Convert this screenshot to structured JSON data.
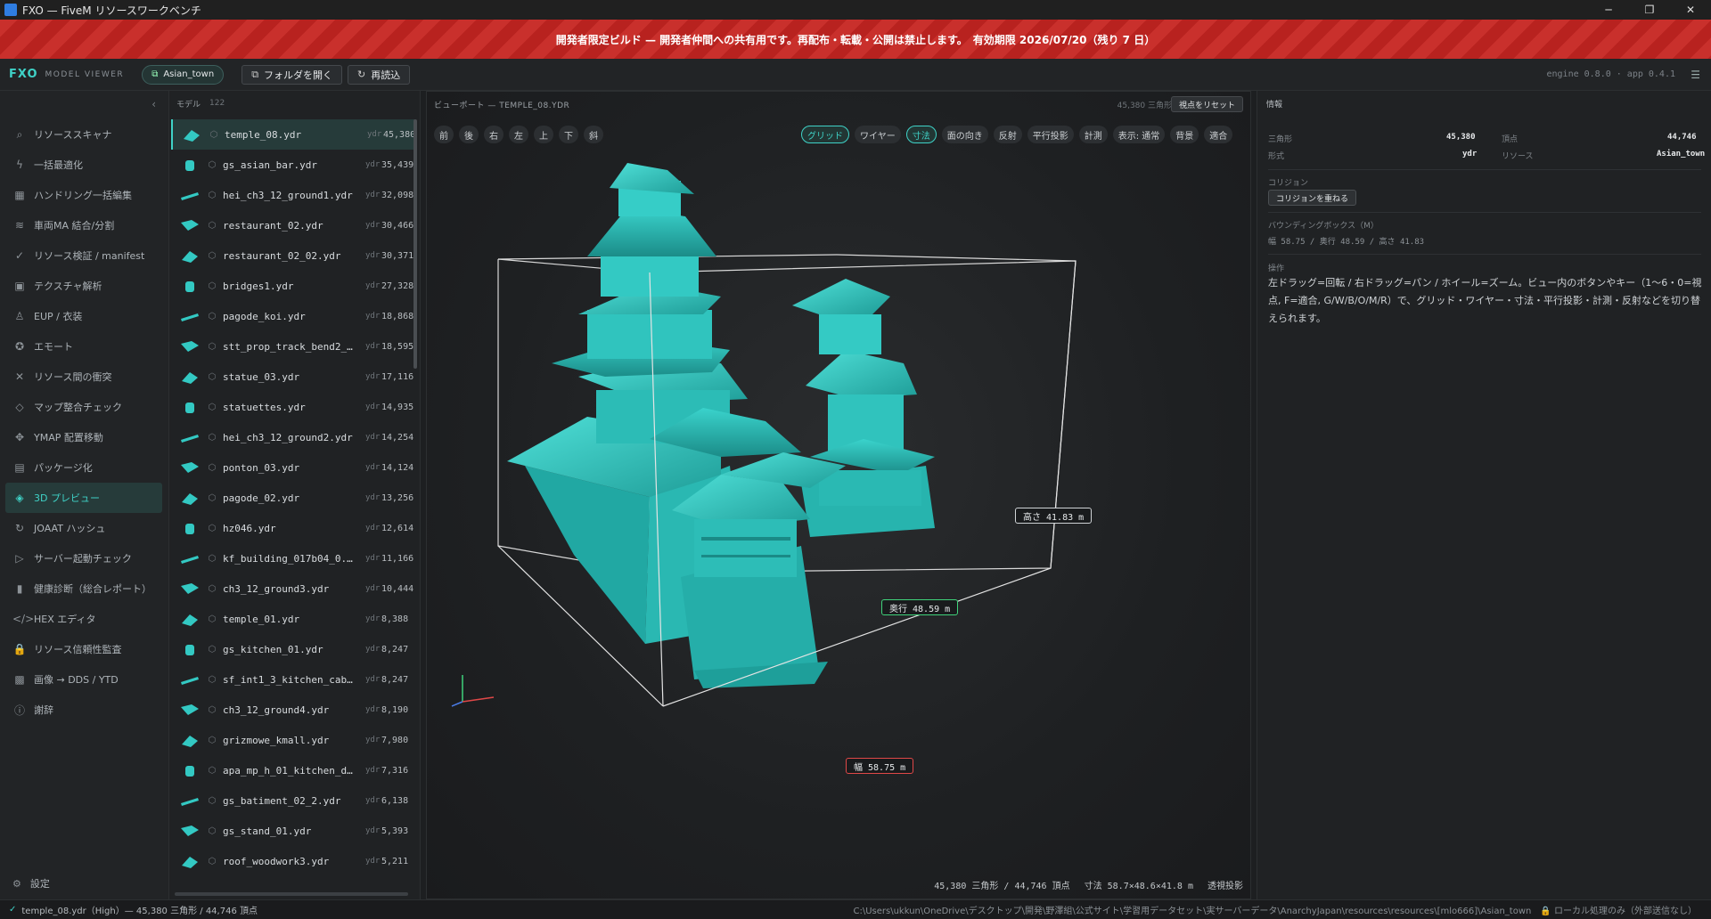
{
  "window": {
    "title": "FXO — FiveM リソースワークベンチ",
    "ctrl_min": "─",
    "ctrl_max": "❐",
    "ctrl_close": "✕"
  },
  "banner": {
    "text": "開発者限定ビルド — 開発者仲間への共有用です。再配布・転載・公開は禁止します。　有効期限 2026/07/20（残り 7 日）"
  },
  "toolbar": {
    "brand": "FXO",
    "brand_sub": "MODEL VIEWER",
    "chip": "Asian_town",
    "open_folder": "フォルダを開く",
    "reload": "再読込",
    "version": "engine 0.8.0 · app 0.4.1"
  },
  "nav": {
    "items": [
      {
        "label": "リソーススキャナ",
        "icon": "search-icon"
      },
      {
        "label": "一括最適化",
        "icon": "bolt-icon"
      },
      {
        "label": "ハンドリング一括編集",
        "icon": "grid-icon"
      },
      {
        "label": "車両MA 結合/分割",
        "icon": "layers-icon"
      },
      {
        "label": "リソース検証 / manifest",
        "icon": "check-circle-icon"
      },
      {
        "label": "テクスチャ解析",
        "icon": "image-icon"
      },
      {
        "label": "EUP / 衣装",
        "icon": "user-icon"
      },
      {
        "label": "エモート",
        "icon": "accessibility-icon"
      },
      {
        "label": "リソース間の衝突",
        "icon": "x-icon"
      },
      {
        "label": "マップ整合チェック",
        "icon": "diamond-icon"
      },
      {
        "label": "YMAP 配置移動",
        "icon": "move-icon"
      },
      {
        "label": "パッケージ化",
        "icon": "package-icon"
      },
      {
        "label": "3D プレビュー",
        "icon": "cube-icon",
        "active": true
      },
      {
        "label": "JOAAT ハッシュ",
        "icon": "refresh-icon"
      },
      {
        "label": "サーバー起動チェック",
        "icon": "play-icon"
      },
      {
        "label": "健康診断（総合レポート）",
        "icon": "bar-chart-icon"
      },
      {
        "label": "HEX エディタ",
        "icon": "code-icon"
      },
      {
        "label": "リソース信頼性監査",
        "icon": "lock-icon"
      },
      {
        "label": "画像 → DDS / YTD",
        "icon": "checker-icon"
      },
      {
        "label": "謝辞",
        "icon": "info-icon"
      }
    ],
    "settings": "設定"
  },
  "models": {
    "header": "モデル",
    "count": "122",
    "rows": [
      {
        "name": "temple_08.ydr",
        "ext": "ydr",
        "tris": "45,380",
        "active": true
      },
      {
        "name": "gs_asian_bar.ydr",
        "ext": "ydr",
        "tris": "35,439"
      },
      {
        "name": "hei_ch3_12_ground1.ydr",
        "ext": "ydr",
        "tris": "32,098"
      },
      {
        "name": "restaurant_02.ydr",
        "ext": "ydr",
        "tris": "30,466"
      },
      {
        "name": "restaurant_02_02.ydr",
        "ext": "ydr",
        "tris": "30,371"
      },
      {
        "name": "bridges1.ydr",
        "ext": "ydr",
        "tris": "27,328"
      },
      {
        "name": "pagode_koi.ydr",
        "ext": "ydr",
        "tris": "18,868"
      },
      {
        "name": "stt_prop_track_bend2_bar_...",
        "ext": "ydr",
        "tris": "18,595"
      },
      {
        "name": "statue_03.ydr",
        "ext": "ydr",
        "tris": "17,116"
      },
      {
        "name": "statuettes.ydr",
        "ext": "ydr",
        "tris": "14,935"
      },
      {
        "name": "hei_ch3_12_ground2.ydr",
        "ext": "ydr",
        "tris": "14,254"
      },
      {
        "name": "ponton_03.ydr",
        "ext": "ydr",
        "tris": "14,124"
      },
      {
        "name": "pagode_02.ydr",
        "ext": "ydr",
        "tris": "13,256"
      },
      {
        "name": "hz046.ydr",
        "ext": "ydr",
        "tris": "12,614"
      },
      {
        "name": "kf_building_017b04_0.ydr",
        "ext": "ydr",
        "tris": "11,166"
      },
      {
        "name": "ch3_12_ground3.ydr",
        "ext": "ydr",
        "tris": "10,444"
      },
      {
        "name": "temple_01.ydr",
        "ext": "ydr",
        "tris": "8,388"
      },
      {
        "name": "gs_kitchen_01.ydr",
        "ext": "ydr",
        "tris": "8,247"
      },
      {
        "name": "sf_int1_3_kitchen_cabinets...",
        "ext": "ydr",
        "tris": "8,247"
      },
      {
        "name": "ch3_12_ground4.ydr",
        "ext": "ydr",
        "tris": "8,190"
      },
      {
        "name": "grizmowe_kmall.ydr",
        "ext": "ydr",
        "tris": "7,980"
      },
      {
        "name": "apa_mp_h_01_kitchen_dini...",
        "ext": "ydr",
        "tris": "7,316"
      },
      {
        "name": "gs_batiment_02_2.ydr",
        "ext": "ydr",
        "tris": "6,138"
      },
      {
        "name": "gs_stand_01.ydr",
        "ext": "ydr",
        "tris": "5,393"
      },
      {
        "name": "roof_woodwork3.ydr",
        "ext": "ydr",
        "tris": "5,211"
      }
    ]
  },
  "viewport": {
    "header": "ビューポート — TEMPLE_08.YDR",
    "tris": "45,380 三角形",
    "reset": "視点をリセット",
    "views": [
      "前",
      "後",
      "右",
      "左",
      "上",
      "下",
      "斜"
    ],
    "toggles": [
      {
        "label": "グリッド",
        "on": true
      },
      {
        "label": "ワイヤー",
        "on": false
      },
      {
        "label": "寸法",
        "on": true
      },
      {
        "label": "面の向き",
        "on": false
      },
      {
        "label": "反射",
        "on": false
      },
      {
        "label": "平行投影",
        "on": false
      },
      {
        "label": "計測",
        "on": false
      },
      {
        "label": "表示: 通常",
        "on": false
      },
      {
        "label": "背景",
        "on": false
      },
      {
        "label": "適合",
        "on": false
      }
    ],
    "height_label": "高さ 41.83 m",
    "depth_label": "奥行 48.59 m",
    "width_label": "幅 58.75 m",
    "status": "45,380 三角形 / 44,746 頂点　 寸法 58.7×48.6×41.8 m　 透視投影"
  },
  "info": {
    "header": "情報",
    "tri_k": "三角形",
    "tri_v": "45,380",
    "vert_k": "頂点",
    "vert_v": "44,746",
    "fmt_k": "形式",
    "fmt_v": "ydr",
    "res_k": "リソース",
    "res_v": "Asian_town",
    "collision": "コリジョン",
    "collision_btn": "コリジョンを重ねる",
    "bbox_k": "バウンディングボックス（M）",
    "bbox_v": "幅 58.75 / 奥行 48.59 / 高さ 41.83",
    "ops_k": "操作",
    "ops_v": "左ドラッグ=回転 / 右ドラッグ=パン / ホイール=ズーム。ビュー内のボタンやキー（1〜6・0=視点, F=適合, G/W/B/O/M/R）で、グリッド・ワイヤー・寸法・平行投影・計測・反射などを切り替えられます。"
  },
  "status": {
    "left": "temple_08.ydr（High）— 45,380 三角形 / 44,746 頂点",
    "path": "C:\\Users\\ukkun\\OneDrive\\デスクトップ\\開発\\野澤組\\公式サイト\\学習用データセット\\実サーバーデータ\\AnarchyJapan\\resources\\resources\\[mlo666]\\Asian_town　🔒 ローカル処理のみ（外部送信なし）"
  },
  "colors": {
    "accent": "#3fd2c7",
    "model": "#33c9c3",
    "banner": "#c9302c"
  }
}
